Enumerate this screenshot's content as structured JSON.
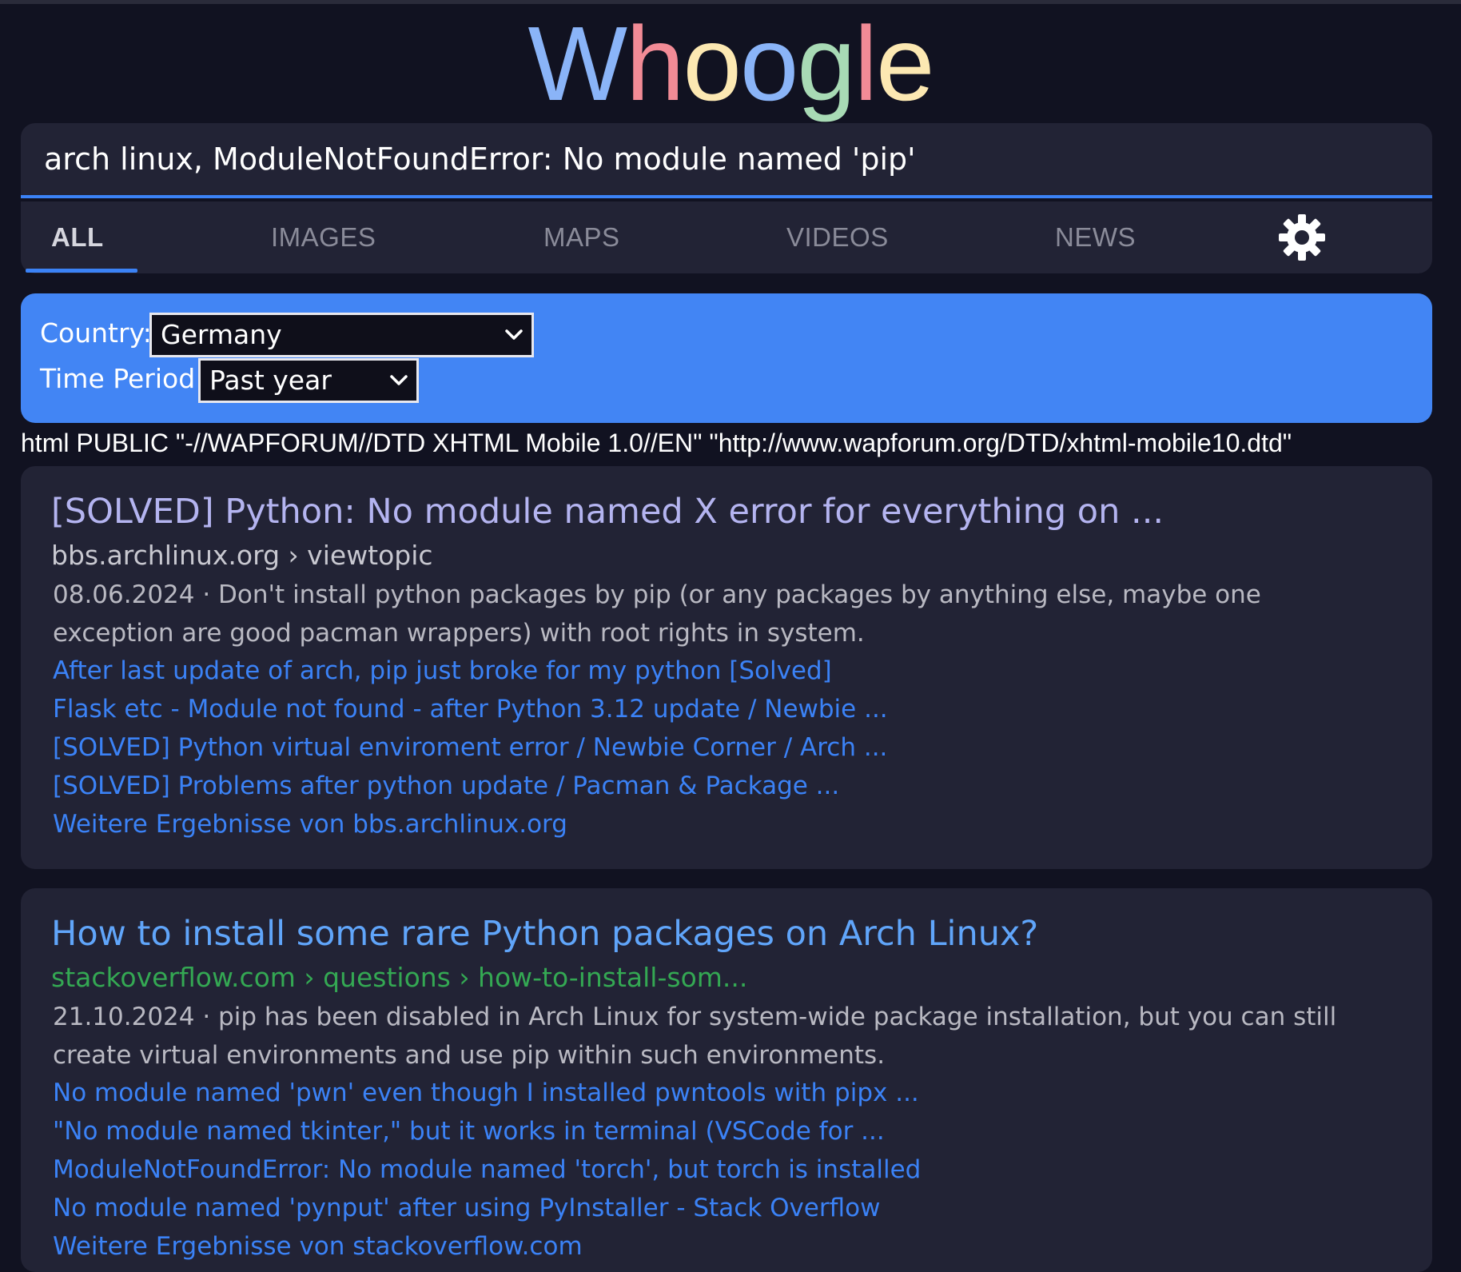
{
  "logo": {
    "letters": [
      {
        "ch": "W",
        "color": "#8ab4f8"
      },
      {
        "ch": "h",
        "color": "#f28b96"
      },
      {
        "ch": "o",
        "color": "#fce8b2"
      },
      {
        "ch": "o",
        "color": "#8ab4f8"
      },
      {
        "ch": "g",
        "color": "#a8dab5"
      },
      {
        "ch": "l",
        "color": "#f28b96"
      },
      {
        "ch": "e",
        "color": "#fce8b2"
      }
    ]
  },
  "search": {
    "query": "arch linux, ModuleNotFoundError: No module named 'pip'"
  },
  "tabs": [
    {
      "label": "ALL",
      "active": true
    },
    {
      "label": "IMAGES",
      "active": false
    },
    {
      "label": "MAPS",
      "active": false
    },
    {
      "label": "VIDEOS",
      "active": false
    },
    {
      "label": "NEWS",
      "active": false
    }
  ],
  "settings_icon": "gear-icon",
  "filters": {
    "country_label": "Country:",
    "country_value": "Germany",
    "period_label": "Time Period:",
    "period_value": "Past year"
  },
  "doctype_text": "html PUBLIC \"-//WAPFORUM//DTD XHTML Mobile 1.0//EN\" \"http://www.wapforum.org/DTD/xhtml-mobile10.dtd\"",
  "results": [
    {
      "title": "[SOLVED] Python: No module named X error for everything on ...",
      "url": "bbs.archlinux.org › viewtopic",
      "snippet": "08.06.2024 · Don't install python packages by pip (or any packages by anything else, maybe one exception are good pacman wrappers) with root rights in system.",
      "sublinks": [
        "After last update of arch, pip just broke for my python [Solved]",
        "Flask etc - Module not found - after Python 3.12 update / Newbie ...",
        "[SOLVED] Python virtual enviroment error / Newbie Corner / Arch ...",
        "[SOLVED] Problems after python update / Pacman & Package ...",
        "Weitere Ergebnisse von bbs.archlinux.org"
      ]
    },
    {
      "title": "How to install some rare Python packages on Arch Linux?",
      "url": "stackoverflow.com › questions › how-to-install-som...",
      "snippet": "21.10.2024 · pip has been disabled in Arch Linux for system-wide package installation, but you can still create virtual environments and use pip within such environments.",
      "sublinks": [
        "No module named 'pwn' even though I installed pwntools with pipx ...",
        "\"No module named tkinter,\" but it works in terminal (VSCode for ...",
        "ModuleNotFoundError: No module named 'torch', but torch is installed",
        "No module named 'pynput' after using PyInstaller - Stack Overflow",
        "Weitere Ergebnisse von stackoverflow.com"
      ]
    }
  ],
  "colors": {
    "background": "#111221",
    "card": "#222335",
    "accent": "#3b82f6",
    "filter_panel": "#4285f4",
    "visited_title": "#b4b4f0",
    "unvisited_title": "#60a5fa",
    "green_url": "#34a853",
    "gray_url": "#c8c8d0",
    "sublink": "#3b82f6"
  }
}
